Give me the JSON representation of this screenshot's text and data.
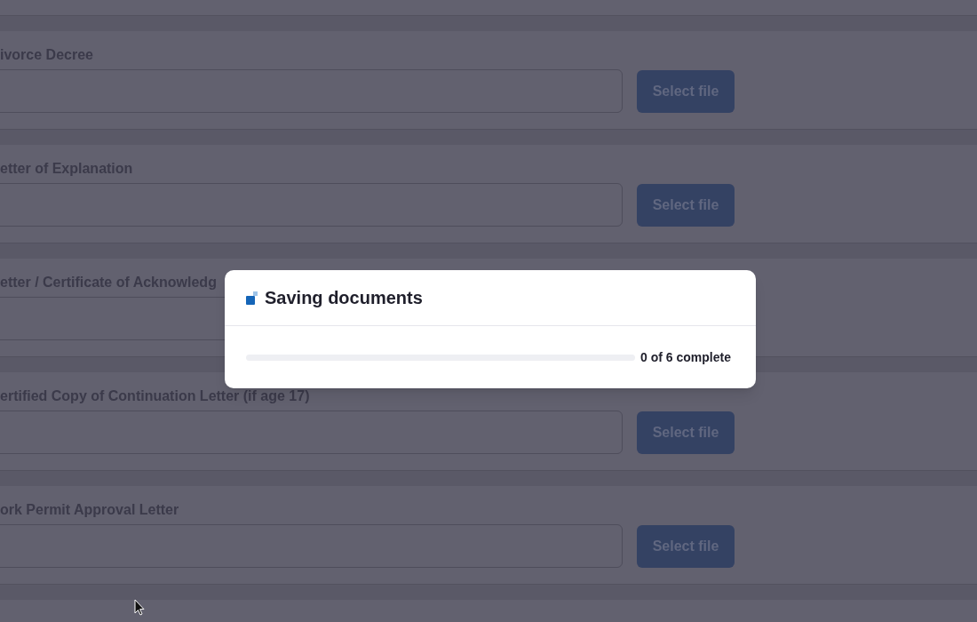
{
  "sections": [
    {
      "label": "ivorce Decree",
      "button": "Select file"
    },
    {
      "label": "etter of Explanation",
      "button": "Select file"
    },
    {
      "label": "etter / Certificate of Acknowledg"
    },
    {
      "label": "ertified Copy of Continuation Letter (if age 17)",
      "button": "Select file"
    },
    {
      "label": "ork Permit Approval Letter",
      "button": "Select file"
    }
  ],
  "dialog": {
    "title": "Saving documents",
    "progress": {
      "level": 0,
      "text": "0 of 6 complete"
    }
  }
}
